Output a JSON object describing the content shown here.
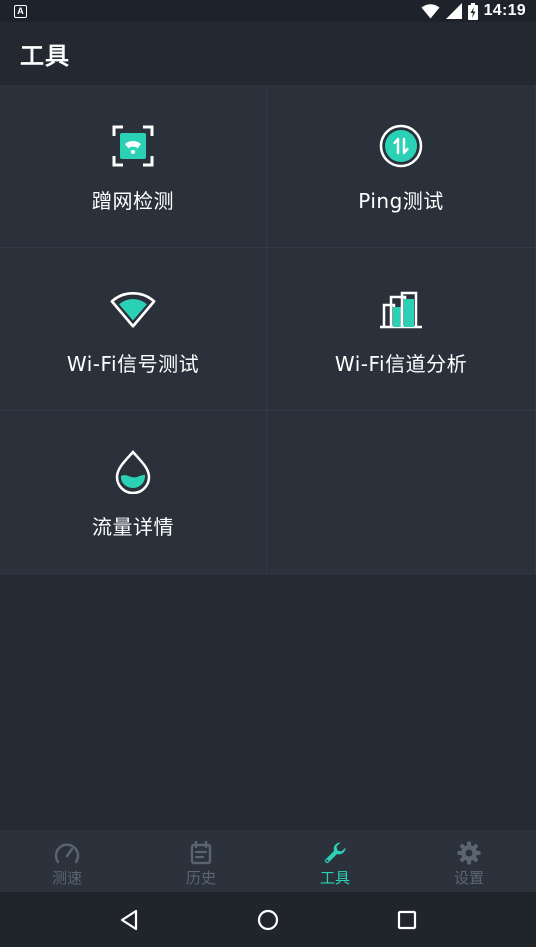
{
  "status_bar": {
    "notification": "A",
    "time": "14:19"
  },
  "app_bar": {
    "title": "工具"
  },
  "tools": [
    {
      "label": "蹭网检测",
      "icon": "scan-wifi-icon"
    },
    {
      "label": "Ping测试",
      "icon": "ping-arrows-icon"
    },
    {
      "label": "Wi-Fi信号测试",
      "icon": "wifi-signal-icon"
    },
    {
      "label": "Wi-Fi信道分析",
      "icon": "channel-bars-icon"
    },
    {
      "label": "流量详情",
      "icon": "data-drop-icon"
    }
  ],
  "bottom_nav": {
    "items": [
      {
        "label": "测速",
        "icon": "speedometer-icon"
      },
      {
        "label": "历史",
        "icon": "calendar-icon"
      },
      {
        "label": "工具",
        "icon": "wrench-icon",
        "active": true
      },
      {
        "label": "设置",
        "icon": "gear-icon"
      }
    ]
  },
  "colors": {
    "accent": "#2bd1b4",
    "background": "#252b35",
    "tile": "#2a313b",
    "inactive": "#5b6572"
  }
}
